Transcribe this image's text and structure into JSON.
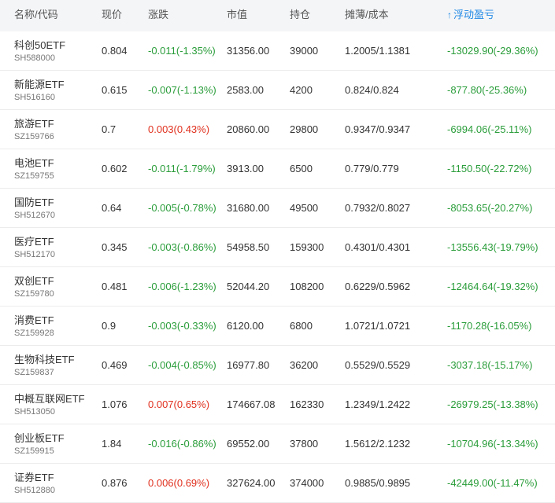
{
  "colors": {
    "header_bg": "#f4f5f7",
    "accent": "#1e88e5",
    "rise": "#e0301e",
    "fall": "#2a9d3a"
  },
  "header": {
    "name": "名称/代码",
    "price": "现价",
    "change": "涨跌",
    "market_value": "市值",
    "holding": "持仓",
    "cost": "摊薄/成本",
    "pnl": "浮动盈亏",
    "pnl_sort_icon": "sort-up-arrow-icon"
  },
  "rows": [
    {
      "name": "科创50ETF",
      "code": "SH588000",
      "price": "0.804",
      "change": "-0.011(-1.35%)",
      "direction": "down",
      "market_value": "31356.00",
      "holding": "39000",
      "cost": "1.2005/1.1381",
      "pnl": "-13029.90(-29.36%)"
    },
    {
      "name": "新能源ETF",
      "code": "SH516160",
      "price": "0.615",
      "change": "-0.007(-1.13%)",
      "direction": "down",
      "market_value": "2583.00",
      "holding": "4200",
      "cost": "0.824/0.824",
      "pnl": "-877.80(-25.36%)"
    },
    {
      "name": "旅游ETF",
      "code": "SZ159766",
      "price": "0.7",
      "change": "0.003(0.43%)",
      "direction": "up",
      "market_value": "20860.00",
      "holding": "29800",
      "cost": "0.9347/0.9347",
      "pnl": "-6994.06(-25.11%)"
    },
    {
      "name": "电池ETF",
      "code": "SZ159755",
      "price": "0.602",
      "change": "-0.011(-1.79%)",
      "direction": "down",
      "market_value": "3913.00",
      "holding": "6500",
      "cost": "0.779/0.779",
      "pnl": "-1150.50(-22.72%)"
    },
    {
      "name": "国防ETF",
      "code": "SH512670",
      "price": "0.64",
      "change": "-0.005(-0.78%)",
      "direction": "down",
      "market_value": "31680.00",
      "holding": "49500",
      "cost": "0.7932/0.8027",
      "pnl": "-8053.65(-20.27%)"
    },
    {
      "name": "医疗ETF",
      "code": "SH512170",
      "price": "0.345",
      "change": "-0.003(-0.86%)",
      "direction": "down",
      "market_value": "54958.50",
      "holding": "159300",
      "cost": "0.4301/0.4301",
      "pnl": "-13556.43(-19.79%)"
    },
    {
      "name": "双创ETF",
      "code": "SZ159780",
      "price": "0.481",
      "change": "-0.006(-1.23%)",
      "direction": "down",
      "market_value": "52044.20",
      "holding": "108200",
      "cost": "0.6229/0.5962",
      "pnl": "-12464.64(-19.32%)"
    },
    {
      "name": "消费ETF",
      "code": "SZ159928",
      "price": "0.9",
      "change": "-0.003(-0.33%)",
      "direction": "down",
      "market_value": "6120.00",
      "holding": "6800",
      "cost": "1.0721/1.0721",
      "pnl": "-1170.28(-16.05%)"
    },
    {
      "name": "生物科技ETF",
      "code": "SZ159837",
      "price": "0.469",
      "change": "-0.004(-0.85%)",
      "direction": "down",
      "market_value": "16977.80",
      "holding": "36200",
      "cost": "0.5529/0.5529",
      "pnl": "-3037.18(-15.17%)"
    },
    {
      "name": "中概互联网ETF",
      "code": "SH513050",
      "price": "1.076",
      "change": "0.007(0.65%)",
      "direction": "up",
      "market_value": "174667.08",
      "holding": "162330",
      "cost": "1.2349/1.2422",
      "pnl": "-26979.25(-13.38%)"
    },
    {
      "name": "创业板ETF",
      "code": "SZ159915",
      "price": "1.84",
      "change": "-0.016(-0.86%)",
      "direction": "down",
      "market_value": "69552.00",
      "holding": "37800",
      "cost": "1.5612/2.1232",
      "pnl": "-10704.96(-13.34%)"
    },
    {
      "name": "证券ETF",
      "code": "SH512880",
      "price": "0.876",
      "change": "0.006(0.69%)",
      "direction": "up",
      "market_value": "327624.00",
      "holding": "374000",
      "cost": "0.9885/0.9895",
      "pnl": "-42449.00(-11.47%)"
    }
  ]
}
